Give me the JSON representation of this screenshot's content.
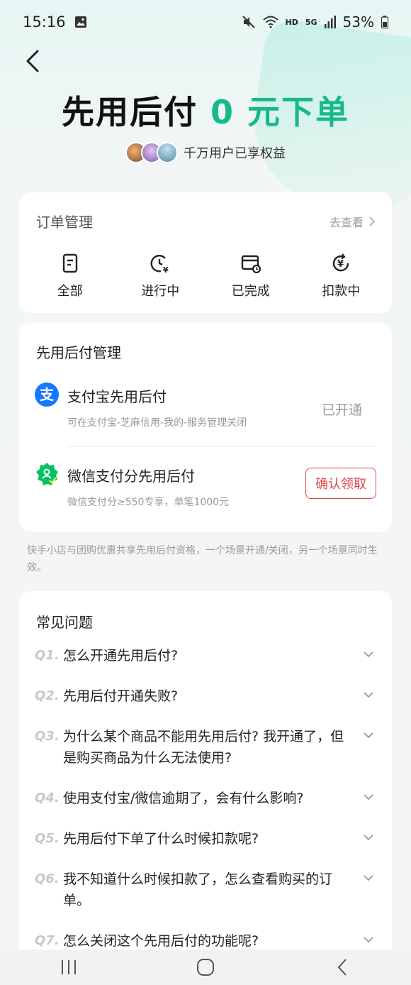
{
  "status": {
    "time": "15:16",
    "hd": "HD",
    "net": "5G",
    "battery": "53%"
  },
  "hero": {
    "title_main": "先用后付",
    "title_accent": "0 元下单",
    "users_text": "千万用户已享权益"
  },
  "orders": {
    "title": "订单管理",
    "link": "去查看",
    "items": [
      {
        "label": "全部",
        "icon": "document-icon"
      },
      {
        "label": "进行中",
        "icon": "clock-yuan-icon"
      },
      {
        "label": "已完成",
        "icon": "card-check-icon"
      },
      {
        "label": "扣款中",
        "icon": "refresh-yuan-icon"
      }
    ]
  },
  "pay": {
    "title": "先用后付管理",
    "alipay": {
      "name": "支付宝先用后付",
      "desc": "可在支付宝-芝麻信用-我的-服务管理关闭",
      "status": "已开通"
    },
    "wechat": {
      "name": "微信支付分先用后付",
      "desc": "微信支付分≥550专享，单笔1000元",
      "button": "确认领取"
    }
  },
  "note": "快手小店与团购优惠共享先用后付资格，一个场景开通/关闭，另一个场景同时生效。",
  "faq": {
    "title": "常见问题",
    "items": [
      {
        "q": "Q1.",
        "text": "怎么开通先用后付?"
      },
      {
        "q": "Q2.",
        "text": "先用后付开通失败?"
      },
      {
        "q": "Q3.",
        "text": "为什么某个商品不能用先用后付? 我开通了，但是购买商品为什么无法使用?"
      },
      {
        "q": "Q4.",
        "text": "使用支付宝/微信逾期了，会有什么影响?"
      },
      {
        "q": "Q5.",
        "text": "先用后付下单了什么时候扣款呢?"
      },
      {
        "q": "Q6.",
        "text": "我不知道什么时候扣款了，怎么查看购买的订单。"
      },
      {
        "q": "Q7.",
        "text": "怎么关闭这个先用后付的功能呢?"
      }
    ]
  },
  "colors": {
    "accent": "#17b987",
    "alipay": "#1677ff",
    "wechat": "#07c160",
    "danger": "#e04848"
  }
}
